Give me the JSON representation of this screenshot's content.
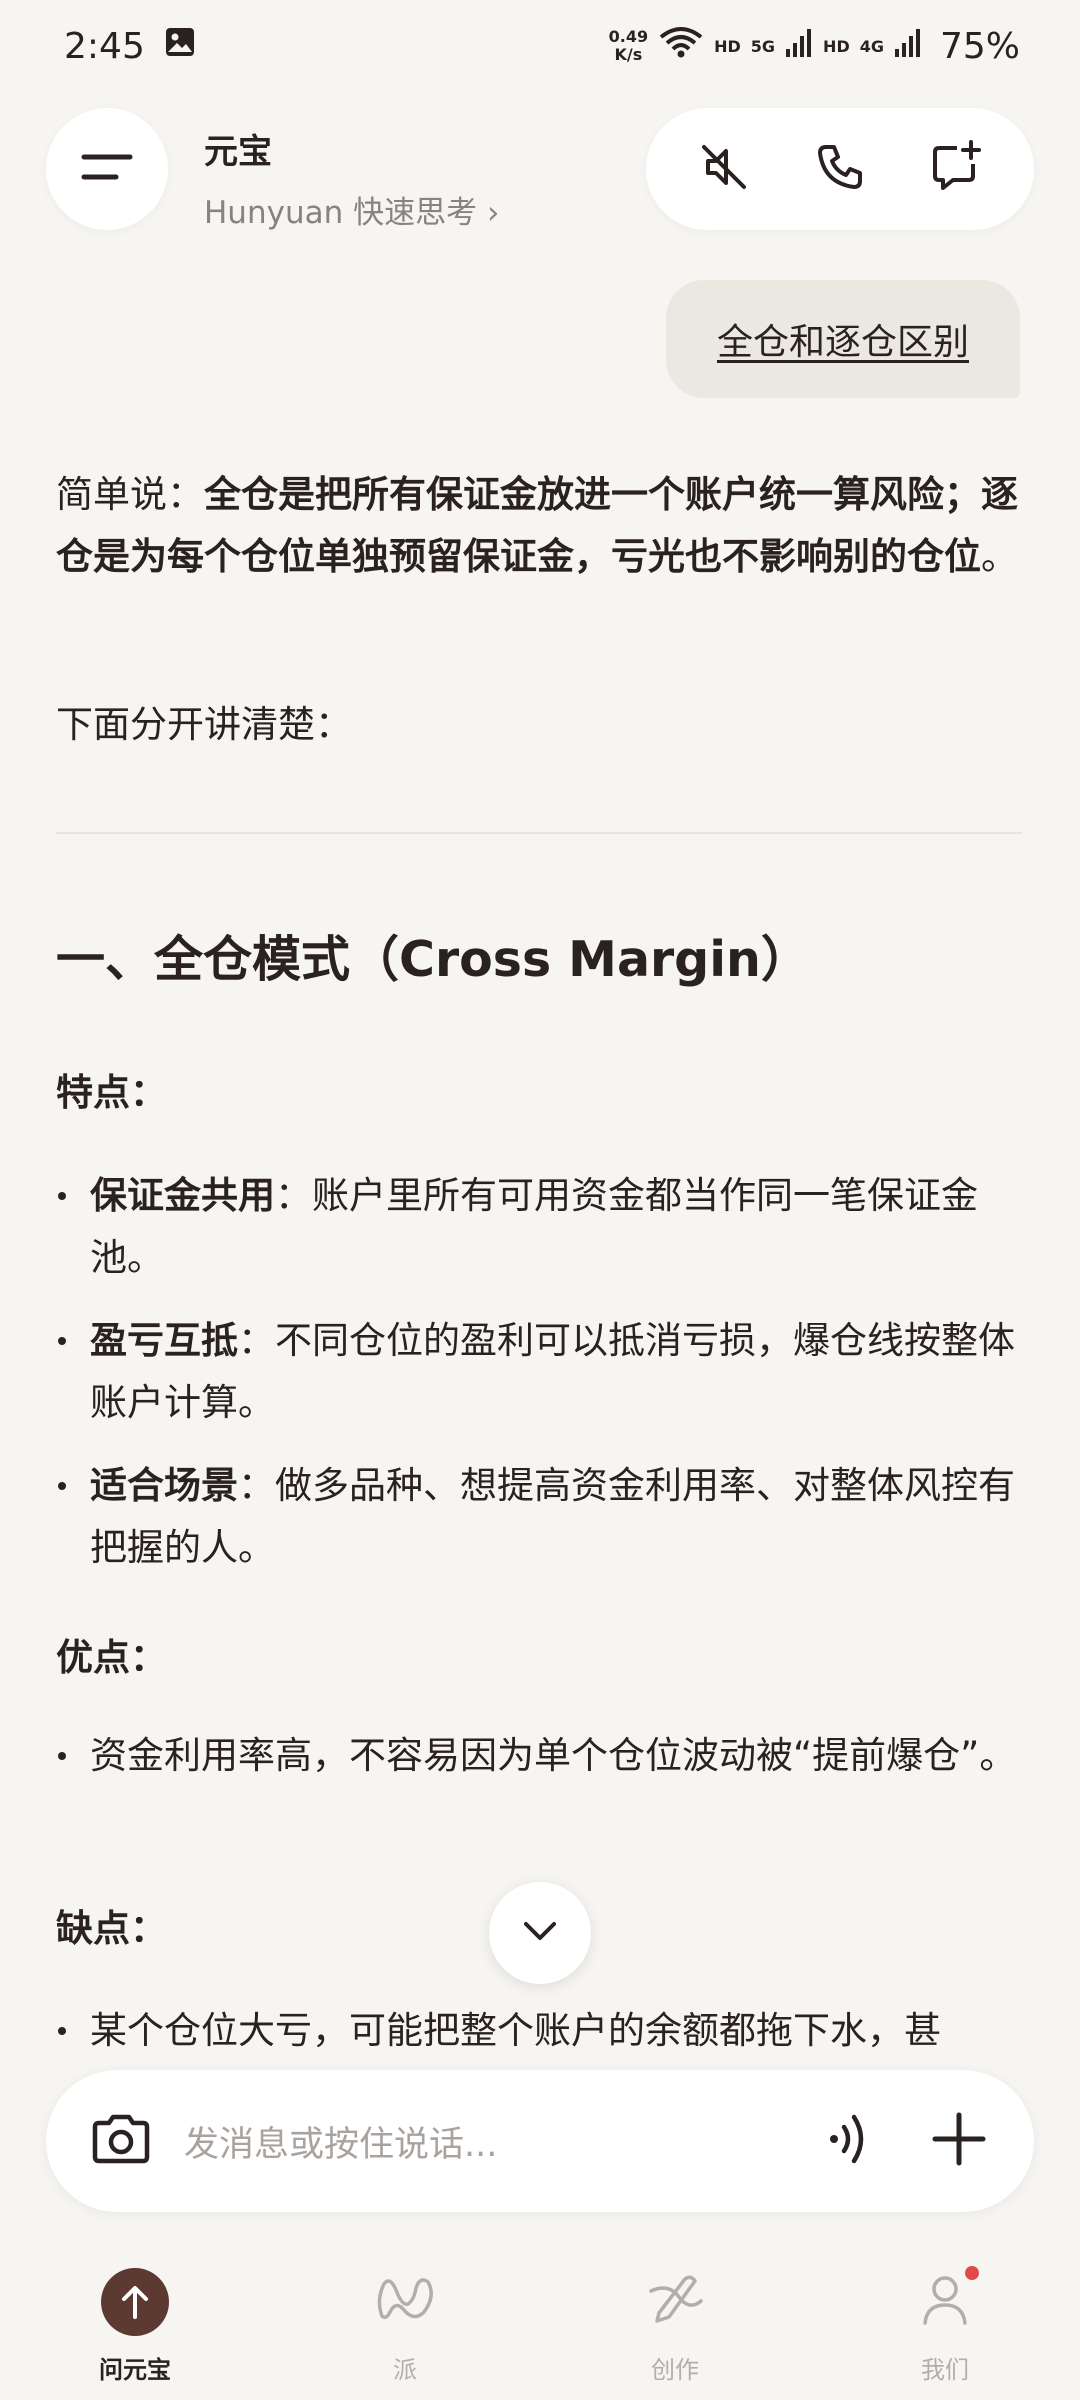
{
  "status_bar": {
    "time": "2:45",
    "net_speed_value": "0.49",
    "net_speed_unit": "K/s",
    "hd1": "HD",
    "sig1": "5G",
    "hd2": "HD",
    "sig2": "4G",
    "battery": "75%"
  },
  "header": {
    "title": "元宝",
    "model": "Hunyuan 快速思考 ›",
    "icons": [
      "menu-icon",
      "mute-icon",
      "phone-icon",
      "new-chat-icon"
    ]
  },
  "chat": {
    "user_message": "全仓和逐仓区别",
    "intro_prefix": "简单说：",
    "intro_bold": "全仓是把所有保证金放进一个账户统一算风险；逐仓是为每个仓位单独预留保证金，亏光也不影响别的仓位",
    "intro_suffix": "。",
    "lead_in": "下面分开讲清楚：",
    "section1_title": "一、全仓模式（Cross Margin）",
    "features_heading": "特点：",
    "features": [
      {
        "term": "保证金共用",
        "desc": "：账户里所有可用资金都当作同一笔保证金池。"
      },
      {
        "term": "盈亏互抵",
        "desc": "：不同仓位的盈利可以抵消亏损，爆仓线按整体账户计算。"
      },
      {
        "term": "适合场景",
        "desc": "：做多品种、想提高资金利用率、对整体风控有把握的人。"
      }
    ],
    "pros_heading": "优点：",
    "pros": [
      "资金利用率高，不容易因为单个仓位波动被“提前爆仓”。"
    ],
    "cons_heading": "缺点：",
    "cons": [
      "某个仓位大亏，可能把整个账户的余额都拖下水，甚"
    ]
  },
  "input": {
    "placeholder": "发消息或按住说话..."
  },
  "nav": {
    "items": [
      {
        "label": "问元宝",
        "icon": "ask-icon"
      },
      {
        "label": "派",
        "icon": "pai-icon"
      },
      {
        "label": "创作",
        "icon": "create-icon"
      },
      {
        "label": "我们",
        "icon": "profile-icon"
      }
    ]
  },
  "colors": {
    "background": "#f7f5f2",
    "accent": "#5c3a32",
    "bubble": "#ebe8e2"
  }
}
